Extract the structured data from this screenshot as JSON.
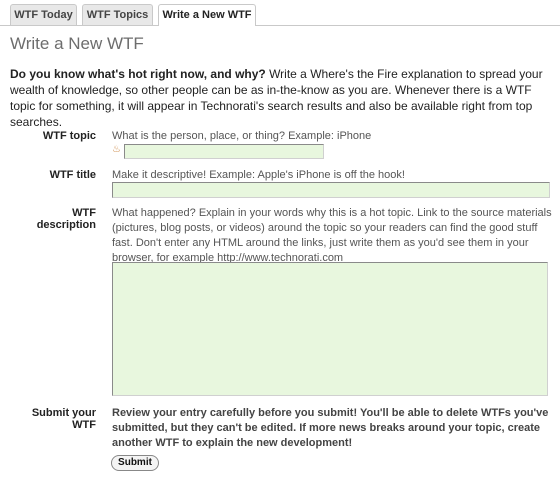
{
  "tabs": [
    {
      "label": "WTF Today",
      "active": false
    },
    {
      "label": "WTF Topics",
      "active": false
    },
    {
      "label": "Write a New WTF",
      "active": true
    }
  ],
  "page_title": "Write a New WTF",
  "intro": {
    "bold": "Do you know what's hot right now, and why?",
    "text": " Write a Where's the Fire explanation to spread your wealth of knowledge, so other people can be as in-the-know as you are. Whenever there is a WTF topic for something, it will appear in Technorati's search results and also be available right from top searches."
  },
  "form": {
    "topic": {
      "label": "WTF topic",
      "hint": "What is the person, place, or thing? Example: iPhone",
      "value": ""
    },
    "title": {
      "label": "WTF title",
      "hint": "Make it descriptive! Example: Apple's iPhone is off the hook!",
      "value": ""
    },
    "description": {
      "label": "WTF description",
      "hint": "What happened? Explain in your words why this is a hot topic. Link to the source materials (pictures, blog posts, or videos) around the topic so your readers can find the good stuff fast. Don't enter any HTML around the links, just write them as you'd see them in your browser, for example http://www.technorati.com",
      "value": ""
    },
    "submit": {
      "label": "Submit your WTF",
      "hint": "Review your entry carefully before you submit! You'll be able to delete WTFs you've submitted, but they can't be edited. If more news breaks around your topic, create another WTF to explain the new development!",
      "button": "Submit"
    }
  },
  "colors": {
    "field_bg": "#e8f7de",
    "title_gray": "#6d6d6d"
  },
  "icons": {
    "topic_marker": "flame-icon"
  }
}
